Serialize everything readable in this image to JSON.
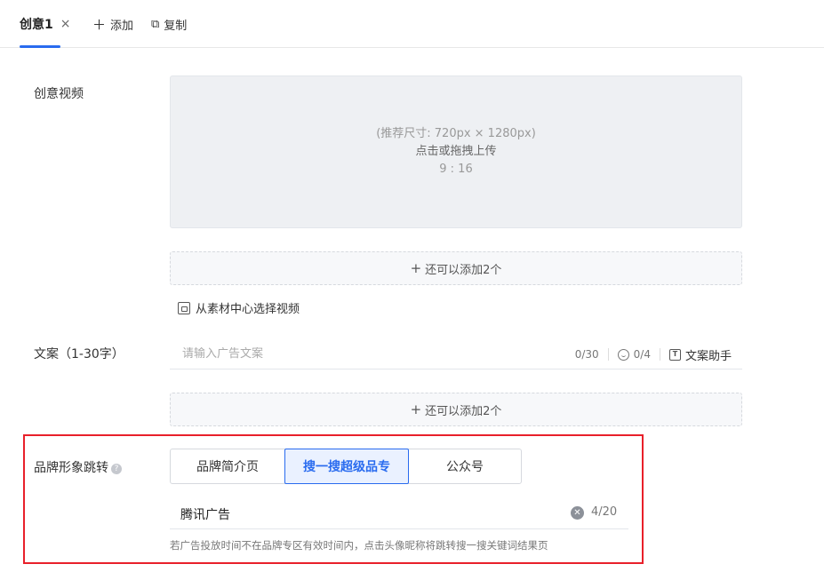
{
  "tabs": {
    "active_label": "创意1",
    "close_symbol": "×",
    "add_label": "添加",
    "copy_label": "复制"
  },
  "video": {
    "label": "创意视频",
    "recommended_size": "(推荐尺寸: 720px × 1280px)",
    "upload_action": "点击或拖拽上传",
    "ratio": "9 : 16",
    "add_more": "还可以添加2个",
    "material_link": "从素材中心选择视频"
  },
  "copy": {
    "label": "文案（1-30字）",
    "placeholder": "请输入广告文案",
    "char_count": "0/30",
    "emoji_count": "0/4",
    "helper_label": "文案助手",
    "add_more": "还可以添加2个"
  },
  "brand": {
    "label": "品牌形象跳转",
    "help_symbol": "?",
    "options": [
      "品牌简介页",
      "搜一搜超级品专",
      "公众号"
    ],
    "selected_index": 1,
    "name_value": "腾讯广告",
    "name_count": "4/20",
    "hint": "若广告投放时间不在品牌专区有效时间内，点击头像昵称将跳转搜一搜关键词结果页"
  },
  "colors": {
    "accent": "#296bef",
    "highlight_border": "#e8202a"
  },
  "icons": {
    "add": "plus-icon",
    "copy": "copy-icon",
    "material": "image-folder-icon",
    "emoji": "smile-icon",
    "helper": "text-box-icon",
    "clear": "clear-circle-icon",
    "help": "question-circle-icon"
  }
}
